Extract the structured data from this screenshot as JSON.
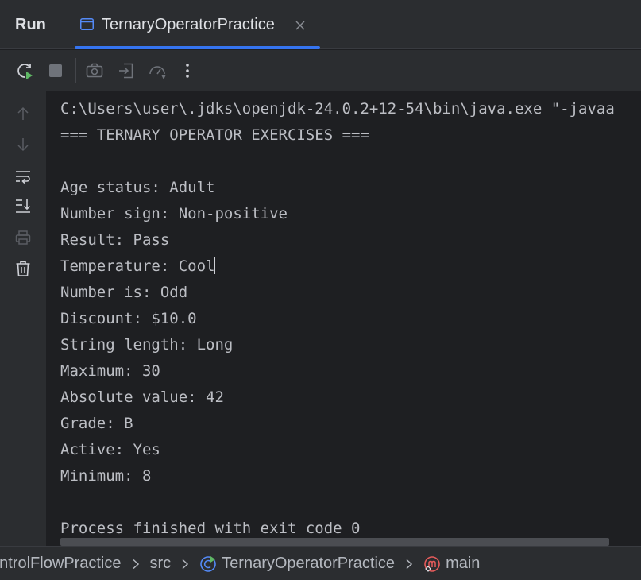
{
  "header": {
    "run_label": "Run",
    "tab": {
      "label": "TernaryOperatorPractice",
      "icon": "console-window-icon",
      "accent": "#3574f0"
    }
  },
  "toolbar": {
    "buttons": [
      "rerun-icon",
      "stop-icon",
      "screenshot-icon",
      "exit-icon",
      "profiler-icon",
      "more-icon"
    ]
  },
  "gutter": {
    "buttons": [
      "arrow-up-icon",
      "arrow-down-icon",
      "soft-wrap-icon",
      "scroll-to-end-icon",
      "print-icon",
      "trash-icon"
    ]
  },
  "console": {
    "lines": [
      "C:\\Users\\user\\.jdks\\openjdk-24.0.2+12-54\\bin\\java.exe \"-javaa",
      "=== TERNARY OPERATOR EXERCISES ===",
      "",
      "Age status: Adult",
      "Number sign: Non-positive",
      "Result: Pass",
      "Temperature: Cool",
      "Number is: Odd",
      "Discount: $10.0",
      "String length: Long",
      "Maximum: 30",
      "Absolute value: 42",
      "Grade: B",
      "Active: Yes",
      "Minimum: 8",
      "",
      "Process finished with exit code 0"
    ]
  },
  "breadcrumb": {
    "project": "ontrolFlowPractice",
    "folder": "src",
    "class": "TernaryOperatorPractice",
    "method": "main"
  }
}
